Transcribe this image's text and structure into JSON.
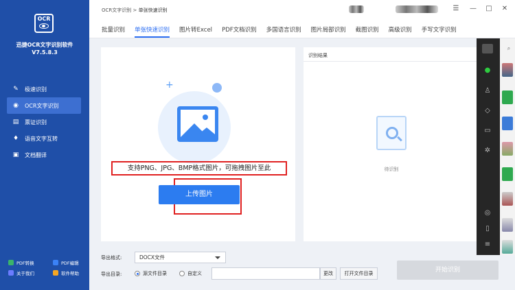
{
  "app": {
    "logo_text": "OCR",
    "name": "迅捷OCR文字识别软件",
    "version": "V7.5.8.3"
  },
  "sidebar": {
    "items": [
      {
        "label": "极速识别",
        "icon": "edit-icon",
        "active": false
      },
      {
        "label": "OCR文字识别",
        "icon": "eye-icon",
        "active": true
      },
      {
        "label": "票证识别",
        "icon": "ticket-icon",
        "active": false
      },
      {
        "label": "语音文字互转",
        "icon": "microphone-icon",
        "active": false
      },
      {
        "label": "文档翻译",
        "icon": "document-translate-icon",
        "active": false
      }
    ],
    "bottom_links": [
      {
        "label": "PDF转换",
        "icon": "pdf-convert-icon",
        "color": "#3ab36b"
      },
      {
        "label": "PDF编辑",
        "icon": "pdf-edit-icon",
        "color": "#3b82f6"
      },
      {
        "label": "关于我们",
        "icon": "info-icon",
        "color": "#6b7cff"
      },
      {
        "label": "软件帮助",
        "icon": "help-icon",
        "color": "#f5a623"
      }
    ]
  },
  "titlebar": {
    "crumb_parent": "OCR文字识别",
    "crumb_sep": ">",
    "crumb_current": "单张快速识别",
    "controls": [
      "☰",
      "—",
      "□",
      "✕"
    ]
  },
  "tabs": [
    {
      "label": "批量识别",
      "active": false
    },
    {
      "label": "单张快速识别",
      "active": true
    },
    {
      "label": "图片转Excel",
      "active": false
    },
    {
      "label": "PDF文档识别",
      "active": false
    },
    {
      "label": "多国语言识别",
      "active": false
    },
    {
      "label": "图片局部识别",
      "active": false
    },
    {
      "label": "截图识别",
      "active": false
    },
    {
      "label": "高级识别",
      "active": false
    },
    {
      "label": "手写文字识别",
      "active": false
    }
  ],
  "upload": {
    "hint": "支持PNG、JPG、BMP格式图片，可拖拽图片至此",
    "button": "上传图片"
  },
  "result": {
    "title": "识别结果",
    "status": "待识别"
  },
  "export": {
    "format_label": "导出格式:",
    "format_value": "DOCX文件",
    "dir_label": "导出目录:",
    "radio_source": "源文件目录",
    "radio_custom": "自定义",
    "change_button": "更改",
    "open_button": "打开文件目录",
    "start_button": "开始识别"
  },
  "colors": {
    "sidebar": "#1f4fa8",
    "accent": "#2c7cf0",
    "highlight_border": "#e02020"
  }
}
